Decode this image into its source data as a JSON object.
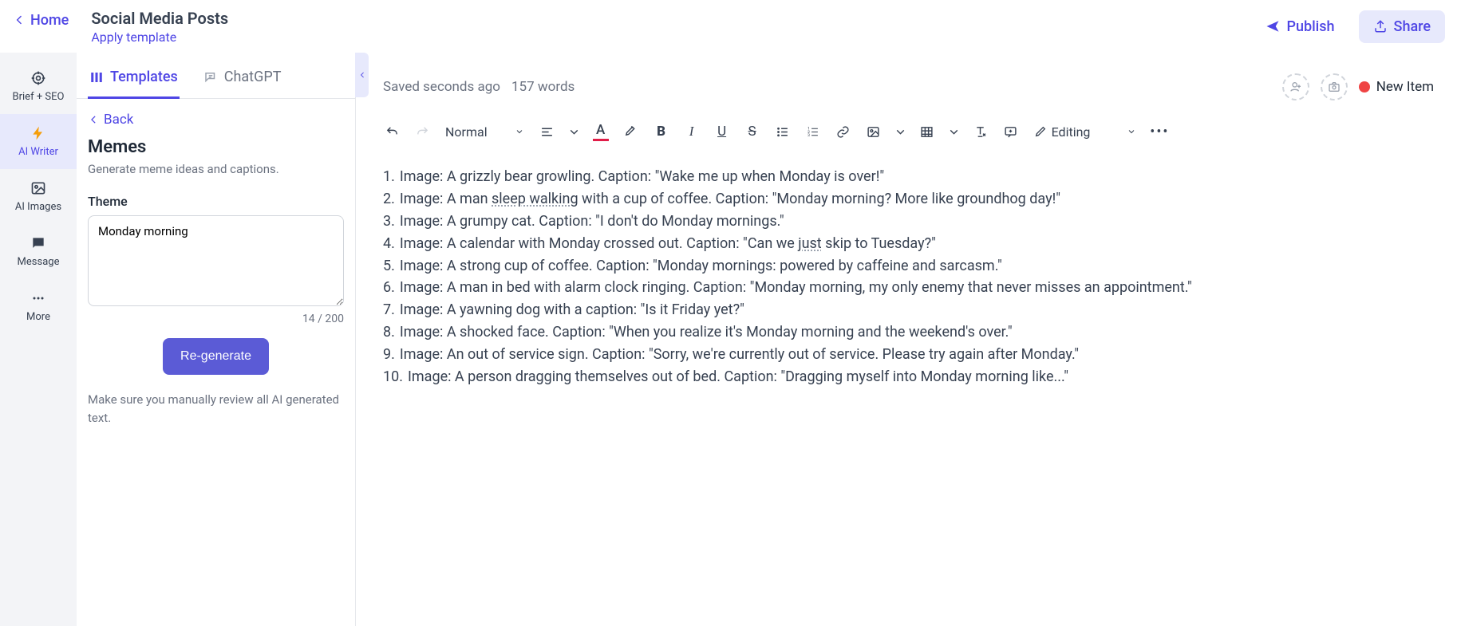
{
  "header": {
    "home_label": "Home",
    "title": "Social Media Posts",
    "apply_template_label": "Apply template",
    "publish_label": "Publish",
    "share_label": "Share"
  },
  "rail": {
    "items": [
      {
        "label": "Brief + SEO"
      },
      {
        "label": "AI Writer"
      },
      {
        "label": "AI Images"
      },
      {
        "label": "Message"
      },
      {
        "label": "More"
      }
    ]
  },
  "panel": {
    "tabs": {
      "templates": "Templates",
      "chatgpt": "ChatGPT"
    },
    "back_label": "Back",
    "template_title": "Memes",
    "template_desc": "Generate meme ideas and captions.",
    "field_label": "Theme",
    "theme_value": "Monday morning",
    "char_count": "14 / 200",
    "regenerate_label": "Re-generate",
    "disclaimer": "Make sure you manually review all AI generated text."
  },
  "editor": {
    "saved_text": "Saved seconds ago",
    "word_count": "157 words",
    "new_item_label": "New Item",
    "paragraph_style": "Normal",
    "editing_mode": "Editing",
    "content_items": [
      "Image: A grizzly bear growling. Caption: \"Wake me up when Monday is over!\"",
      "Image: A man sleep walking with a cup of coffee. Caption: \"Monday morning? More like groundhog day!\"",
      "Image: A grumpy cat. Caption: \"I don't do Monday mornings.\"",
      "Image: A calendar with Monday crossed out. Caption: \"Can we just skip to Tuesday?\"",
      "Image: A strong cup of coffee. Caption: \"Monday mornings: powered by caffeine and sarcasm.\"",
      "Image: A man in bed with alarm clock ringing. Caption: \"Monday morning, my only enemy that never misses an appointment.\"",
      "Image: A yawning dog with a caption: \"Is it Friday yet?\"",
      "Image: A shocked face. Caption: \"When you realize it's Monday morning and the weekend's over.\"",
      "Image: An out of service sign. Caption: \"Sorry, we're currently out of service. Please try again after Monday.\"",
      "Image: A person dragging themselves out of bed. Caption: \"Dragging myself into Monday morning like...\""
    ]
  }
}
